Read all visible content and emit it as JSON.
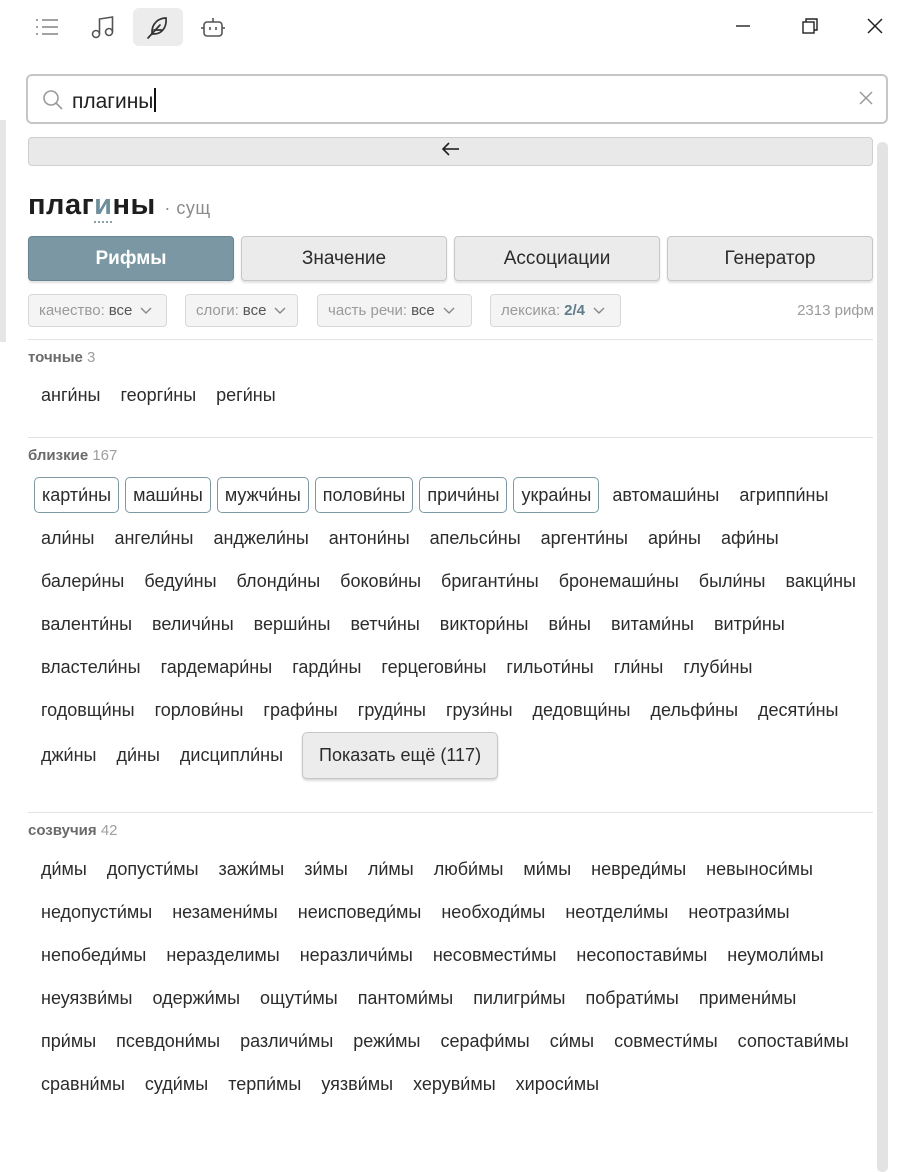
{
  "toolbar": {
    "icons": [
      "list-icon",
      "music-note-icon",
      "feather-icon",
      "robot-icon"
    ],
    "active": "feather-icon"
  },
  "window_controls": [
    "minimize-icon",
    "restore-icon",
    "close-icon"
  ],
  "search": {
    "value": "плагины"
  },
  "headword": {
    "pre": "плаг",
    "stressed": "и",
    "post": "ны",
    "pos": "· сущ"
  },
  "tabs": [
    {
      "label": "Рифмы",
      "active": true
    },
    {
      "label": "Значение",
      "active": false
    },
    {
      "label": "Ассоциации",
      "active": false
    },
    {
      "label": "Генератор",
      "active": false
    }
  ],
  "filters": {
    "quality": {
      "label": "качество:",
      "value": "все"
    },
    "syllables": {
      "label": "слоги:",
      "value": "все"
    },
    "pos": {
      "label": "часть речи:",
      "value": "все"
    },
    "lexicon": {
      "label": "лексика:",
      "value": "2/4"
    }
  },
  "count": "2313 рифм",
  "sections": {
    "exact": {
      "title": "точные",
      "n": "3",
      "words": [
        "анги́ны",
        "георги́ны",
        "реги́ны"
      ]
    },
    "close": {
      "title": "близкие",
      "n": "167",
      "boxed": [
        "карти́ны",
        "маши́ны",
        "мужчи́ны",
        "полови́ны",
        "причи́ны",
        "украи́ны"
      ],
      "words": [
        "автомаши́ны",
        "агриппи́ны",
        "али́ны",
        "ангели́ны",
        "анджели́ны",
        "антони́ны",
        "апельси́ны",
        "аргенти́ны",
        "ари́ны",
        "афи́ны",
        "балери́ны",
        "бедуи́ны",
        "блонди́ны",
        "бокови́ны",
        "бриганти́ны",
        "бронемаши́ны",
        "были́ны",
        "вакци́ны",
        "валенти́ны",
        "величи́ны",
        "верши́ны",
        "ветчи́ны",
        "виктори́ны",
        "ви́ны",
        "витами́ны",
        "витри́ны",
        "властели́ны",
        "гардемари́ны",
        "гарди́ны",
        "герцегови́ны",
        "гильоти́ны",
        "гли́ны",
        "глуби́ны",
        "годовщи́ны",
        "горлови́ны",
        "графи́ны",
        "груди́ны",
        "грузи́ны",
        "дедовщи́ны",
        "дельфи́ны",
        "десяти́ны",
        "джи́ны",
        "ди́ны",
        "дисципли́ны"
      ],
      "more": "Показать ещё (117)"
    },
    "assonance": {
      "title": "созвучия",
      "n": "42",
      "words": [
        "ди́мы",
        "допусти́мы",
        "зажи́мы",
        "зи́мы",
        "ли́мы",
        "люби́мы",
        "ми́мы",
        "невреди́мы",
        "невыноси́мы",
        "недопусти́мы",
        "незамени́мы",
        "неисповеди́мы",
        "необходи́мы",
        "неотдели́мы",
        "неотрази́мы",
        "непобеди́мы",
        "неразделимы",
        "неразличи́мы",
        "несовмести́мы",
        "несопостави́мы",
        "неумоли́мы",
        "неуязви́мы",
        "одержи́мы",
        "ощути́мы",
        "пантоми́мы",
        "пилигри́мы",
        "побрати́мы",
        "примени́мы",
        "при́мы",
        "псевдони́мы",
        "различи́мы",
        "режи́мы",
        "серафи́мы",
        "си́мы",
        "совмести́мы",
        "сопостави́мы",
        "сравни́мы",
        "суди́мы",
        "терпи́мы",
        "уязви́мы",
        "херуви́мы",
        "хироси́мы"
      ]
    }
  }
}
